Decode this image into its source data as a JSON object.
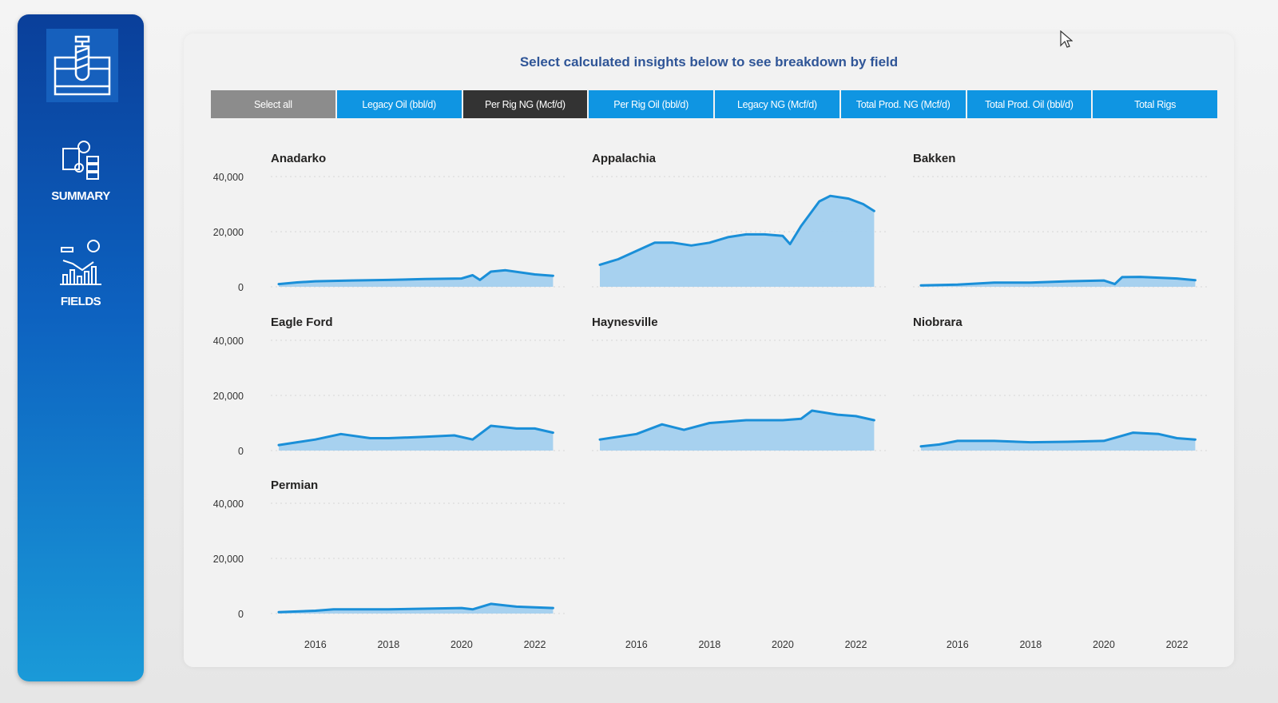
{
  "sidebar": {
    "logo_icon": "drill-ground-icon",
    "items": [
      {
        "label": "SUMMARY",
        "icon": "summary-gear-document-icon"
      },
      {
        "label": "FIELDS",
        "icon": "fields-bar-chart-dollar-icon"
      }
    ]
  },
  "header": {
    "title": "Select calculated insights below to see breakdown by field"
  },
  "slicer": {
    "buttons": [
      {
        "label": "Select all",
        "state": "select-all"
      },
      {
        "label": "Legacy Oil (bbl/d)",
        "state": "normal"
      },
      {
        "label": "Per Rig NG (Mcf/d)",
        "state": "selected"
      },
      {
        "label": "Per Rig Oil (bbl/d)",
        "state": "normal"
      },
      {
        "label": "Legacy NG (Mcf/d)",
        "state": "normal"
      },
      {
        "label": "Total Prod. NG (Mcf/d)",
        "state": "normal"
      },
      {
        "label": "Total Prod. Oil (bbl/d)",
        "state": "normal"
      },
      {
        "label": "Total Rigs",
        "state": "normal"
      }
    ]
  },
  "colors": {
    "accent": "#0f95e2",
    "selected": "#333333",
    "select_all": "#8c8c8c",
    "line": "#1a8fd8",
    "area": "#9fcdee",
    "title": "#2f5597"
  },
  "chart_data": {
    "type": "area",
    "layout": "small-multiples",
    "grid": true,
    "ylim": [
      0,
      40000
    ],
    "yticks": [
      "0",
      "20,000",
      "40,000"
    ],
    "xticks": [
      "2016",
      "2018",
      "2020",
      "2022"
    ],
    "xlim": [
      2015,
      2022.6
    ],
    "panels": [
      {
        "name": "Anadarko",
        "x": [
          2015,
          2015.5,
          2016,
          2017,
          2018,
          2019,
          2020,
          2020.3,
          2020.5,
          2020.8,
          2021.2,
          2022,
          2022.5
        ],
        "y": [
          1000,
          1600,
          2000,
          2300,
          2500,
          2800,
          3000,
          4200,
          2500,
          5500,
          6000,
          4500,
          4000
        ]
      },
      {
        "name": "Appalachia",
        "x": [
          2015,
          2015.5,
          2016,
          2016.5,
          2017,
          2017.5,
          2018,
          2018.5,
          2019,
          2019.5,
          2020,
          2020.2,
          2020.5,
          2021,
          2021.3,
          2021.8,
          2022.2,
          2022.5
        ],
        "y": [
          8000,
          10000,
          13000,
          16000,
          16000,
          15000,
          16000,
          18000,
          19000,
          19000,
          18500,
          15500,
          22000,
          31000,
          33000,
          32000,
          30000,
          27500
        ]
      },
      {
        "name": "Bakken",
        "x": [
          2015,
          2016,
          2017,
          2018,
          2019,
          2020,
          2020.3,
          2020.5,
          2021,
          2022,
          2022.5
        ],
        "y": [
          500,
          800,
          1500,
          1500,
          2000,
          2300,
          1000,
          3500,
          3600,
          3000,
          2400
        ]
      },
      {
        "name": "Eagle Ford",
        "x": [
          2015,
          2015.5,
          2016,
          2016.7,
          2017.5,
          2018,
          2019,
          2019.8,
          2020.3,
          2020.8,
          2021.5,
          2022,
          2022.5
        ],
        "y": [
          2000,
          3000,
          4000,
          6000,
          4500,
          4500,
          5000,
          5500,
          4000,
          9000,
          8000,
          8000,
          6500
        ]
      },
      {
        "name": "Haynesville",
        "x": [
          2015,
          2016,
          2016.7,
          2017.3,
          2018,
          2019,
          2020,
          2020.5,
          2020.8,
          2021.5,
          2022,
          2022.5
        ],
        "y": [
          4000,
          6000,
          9500,
          7500,
          10000,
          11000,
          11000,
          11500,
          14500,
          13000,
          12500,
          11000
        ]
      },
      {
        "name": "Niobrara",
        "x": [
          2015,
          2015.5,
          2016,
          2017,
          2018,
          2019,
          2020,
          2020.8,
          2021.5,
          2022,
          2022.5
        ],
        "y": [
          1500,
          2200,
          3500,
          3500,
          3000,
          3200,
          3500,
          6500,
          6000,
          4500,
          4000
        ]
      },
      {
        "name": "Permian",
        "x": [
          2015,
          2016,
          2016.5,
          2018,
          2020,
          2020.3,
          2020.8,
          2021.5,
          2022.5
        ],
        "y": [
          500,
          1000,
          1500,
          1500,
          2000,
          1500,
          3500,
          2500,
          2000
        ]
      }
    ]
  }
}
